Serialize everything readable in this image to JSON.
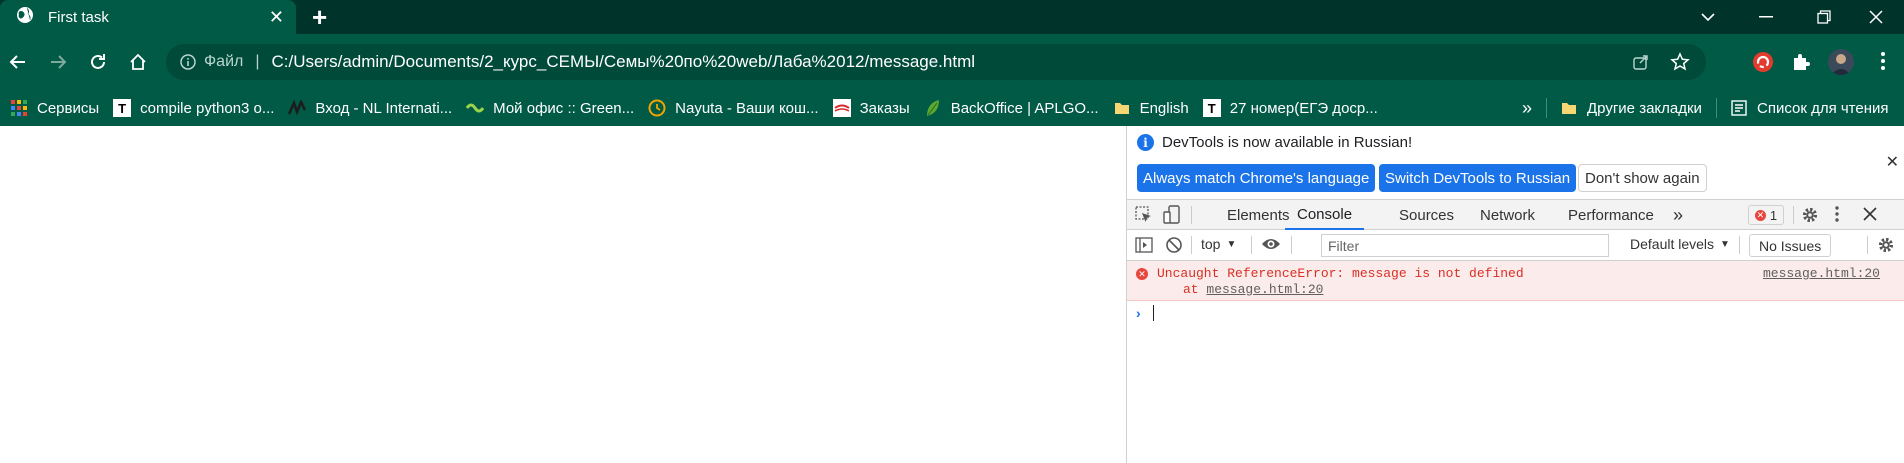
{
  "tab": {
    "title": "First task",
    "close": "✕",
    "new_tab": "+"
  },
  "window_controls": {
    "minimize": "—",
    "maximize": "❐",
    "close": "✕",
    "tab_search": "⌄"
  },
  "toolbar": {
    "site_info_label": "Файл",
    "url": "C:/Users/admin/Documents/2_курс_СЕМЫ/Семы%20по%20web/Лаба%2012/message.html"
  },
  "bookmarks": {
    "items": [
      {
        "label": "Сервисы",
        "icon": "apps-grid-icon"
      },
      {
        "label": "compile python3 o...",
        "icon": "T"
      },
      {
        "label": "Вход - NL Internati...",
        "icon": "nl-icon"
      },
      {
        "label": "Мой офис :: Green...",
        "icon": "green-icon"
      },
      {
        "label": "Nayuta - Ваши кош...",
        "icon": "nayuta-icon"
      },
      {
        "label": "Заказы",
        "icon": "orders-icon"
      },
      {
        "label": "BackOffice | APLGO...",
        "icon": "leaf-icon"
      },
      {
        "label": "English",
        "icon": "folder-icon"
      },
      {
        "label": "27 номер(ЕГЭ доср...",
        "icon": "T"
      }
    ],
    "more": "»",
    "other_bookmarks": "Другие закладки",
    "reading_list": "Список для чтения"
  },
  "devtools": {
    "infobar": {
      "message": "DevTools is now available in Russian!",
      "btn_match": "Always match Chrome's language",
      "btn_switch": "Switch DevTools to Russian",
      "btn_dont_show": "Don't show again",
      "close": "✕"
    },
    "tabs": [
      "Elements",
      "Console",
      "Sources",
      "Network",
      "Performance"
    ],
    "active_tab": "Console",
    "more_tabs": "»",
    "error_count": "1",
    "console_toolbar": {
      "context": "top",
      "filter_placeholder": "Filter",
      "levels": "Default levels",
      "issues": "No Issues"
    },
    "error": {
      "message": "Uncaught ReferenceError: message is not defined",
      "trace_prefix": "at ",
      "trace_link": "message.html:20",
      "source": "message.html:20"
    },
    "prompt": "›"
  },
  "colors": {
    "frame": "#00332a",
    "toolbar": "#005a46",
    "accent": "#1a73e8",
    "error": "#d93025"
  }
}
